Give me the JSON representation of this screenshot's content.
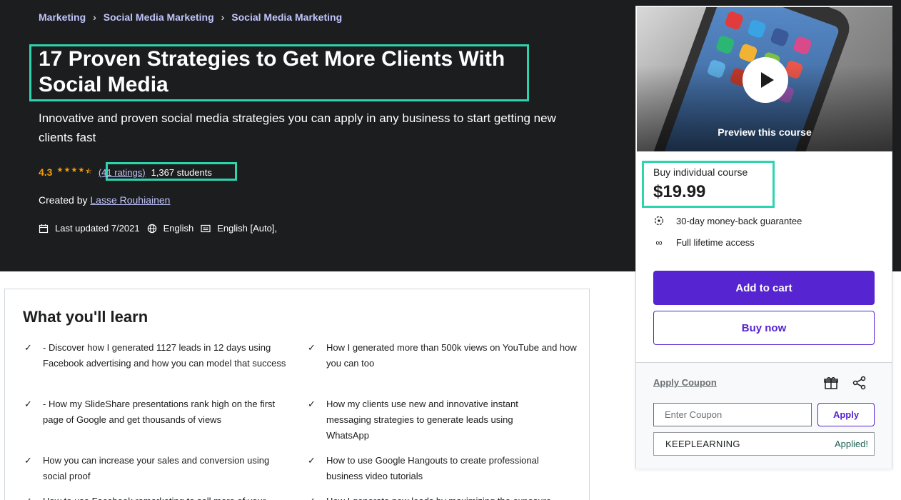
{
  "breadcrumb": [
    "Marketing",
    "Social Media Marketing",
    "Social Media Marketing"
  ],
  "course": {
    "title": "17 Proven Strategies to Get More Clients With Social Media",
    "subtitle": "Innovative and proven social media strategies you can apply in any business to start getting new clients fast",
    "rating": "4.3",
    "ratings_link": "(41 ratings)",
    "students": "1,367 students",
    "created_by_label": "Created by",
    "instructor": "Lasse Rouhiainen",
    "last_updated": "Last updated 7/2021",
    "language": "English",
    "captions": "English [Auto],"
  },
  "learn": {
    "heading": "What you'll learn",
    "items": [
      "- Discover how I generated 1127 leads in 12 days using Facebook advertising and how you can model that success",
      "How I generated more than 500k views on YouTube and how you can too",
      "- How my SlideShare presentations rank high on the first page of Google and get thousands of views",
      "How my clients use new and innovative instant messaging strategies to generate leads using WhatsApp",
      "How you can increase your sales and conversion using social proof",
      "How to use Google Hangouts to create professional business video tutorials",
      "How to use Facebook remarketing to sell more of your",
      "How I generate new leads by maximizing the exposure"
    ]
  },
  "sidebar": {
    "preview_label": "Preview this course",
    "price_label": "Buy individual course",
    "price": "$19.99",
    "features": [
      "30-day money-back guarantee",
      "Full lifetime access"
    ],
    "add_to_cart": "Add to cart",
    "buy_now": "Buy now",
    "apply_coupon": "Apply Coupon",
    "coupon_placeholder": "Enter Coupon",
    "coupon_apply_button": "Apply",
    "applied_code": "KEEPLEARNING",
    "applied_status": "Applied!"
  },
  "colors": {
    "hero_bg": "#1c1d1f",
    "accent_purple": "#5624d0",
    "link_purple": "#c0c4fc",
    "star": "#f69c08",
    "highlight": "#2dd4ad"
  },
  "icons": [
    "star-icon",
    "calendar-icon",
    "globe-icon",
    "captions-icon",
    "check-icon",
    "play-icon",
    "clock-guarantee-icon",
    "infinity-icon",
    "gift-icon",
    "share-icon"
  ]
}
